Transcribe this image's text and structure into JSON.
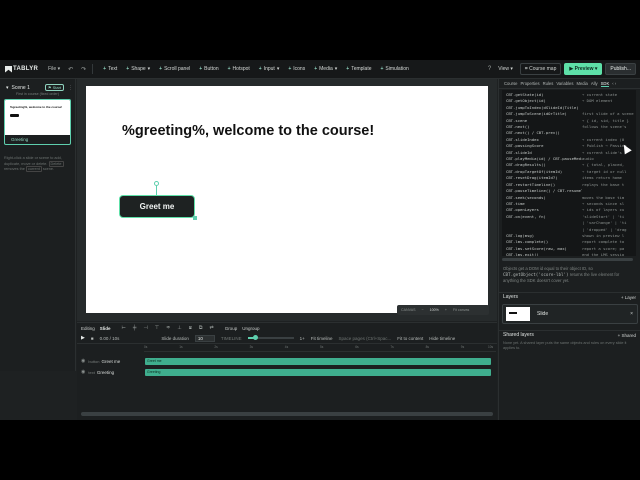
{
  "app": {
    "name": "TABLYR",
    "menu_file": "File"
  },
  "toolbar": {
    "insert": [
      {
        "label": "Text",
        "name": "text"
      },
      {
        "label": "Shape",
        "name": "shape",
        "caret": true
      },
      {
        "label": "Scroll panel",
        "name": "scroll-panel"
      },
      {
        "label": "Button",
        "name": "button"
      },
      {
        "label": "Hotspot",
        "name": "hotspot"
      },
      {
        "label": "Input",
        "name": "input",
        "caret": true
      },
      {
        "label": "Icons",
        "name": "icons"
      },
      {
        "label": "Media",
        "name": "media",
        "caret": true
      },
      {
        "label": "Template",
        "name": "template"
      },
      {
        "label": "Simulation",
        "name": "simulation"
      }
    ],
    "help": "?",
    "view": "View",
    "course_map": "Course map",
    "preview": "Preview",
    "publish": "Publish..."
  },
  "scenes": {
    "scene_title": "Scene 1",
    "start_badge": "Start",
    "scene_subtitle": "First in course (fixed order)",
    "thumb_title": "%greeting%, welcome to the course!",
    "slide_label": "Greeting",
    "help_text_1": "Right-click a slide or scene to add,",
    "help_text_2": "duplicate, move or delete.",
    "help_key": "Delete",
    "help_text_3": "removes",
    "help_text_4": "the ",
    "help_key2": "current",
    "help_text_5": " scene."
  },
  "canvas": {
    "title": "%greeting%, welcome to the course!",
    "button_label": "Greet me",
    "zoom_label": "CANVAS",
    "zoom_value": "100%",
    "fit_label": "Fit canvas"
  },
  "timeline": {
    "editing_label": "Editing",
    "editing_target": "Slide",
    "group": "Group",
    "ungroup": "Ungroup",
    "time": "0.00 / 10s",
    "duration_label": "Slide duration",
    "duration_value": "10",
    "timeline_label": "TIMELINE",
    "zoom_fraction": 0.15,
    "plus": "1+",
    "fit_timeline": "Fit timeline",
    "space_hint": "Space pages (Ctrl+Spac...",
    "fit_content": "Fit to content",
    "hide_timeline": "Hide timeline",
    "ticks": [
      "0s",
      "1s",
      "2s",
      "3s",
      "4s",
      "5s",
      "6s",
      "7s",
      "8s",
      "9s",
      "10s"
    ],
    "rows": [
      {
        "type": "button",
        "name": "Greet me",
        "bar": "Greet me"
      },
      {
        "type": "text",
        "name": "Greeting",
        "bar": "Greeting"
      }
    ]
  },
  "right_panel": {
    "tabs": [
      "Course",
      "Properties",
      "Rules",
      "Variables",
      "Media",
      "Ally",
      "SDK"
    ],
    "active_tab": "SDK",
    "code": [
      [
        "CBT.getState(id)",
        "→ current state"
      ],
      [
        "CBT.getObject(id)",
        "→ DOM element"
      ],
      [
        "CBT.jumpToIndex(dSlideId)Title)",
        ""
      ],
      [
        "CBT.jumpToScene(idOrTitle)",
        "first slide of a scene"
      ],
      [
        "CBT.scene",
        "→ { id, sid, title }"
      ],
      [
        "CBT.next()",
        "follows the scene's"
      ],
      [
        "CBT.next() / CBT.prev()",
        ""
      ],
      [
        "CBT.slideIndex",
        "→ current index (0"
      ],
      [
        "CBT.passingScore",
        "→ Publish → Passing"
      ],
      [
        "CBT.slideId",
        "→ current slide's"
      ],
      [
        "CBT.playMedia(id) / CBT.pauseMedia(id)",
        "audio"
      ],
      [
        "CBT.dragResults()",
        "→ { total, placed,"
      ],
      [
        "CBT.dropTargetOf(itemId)",
        "→ target id or null"
      ],
      [
        "CBT.resetDrag(itemId?)",
        "items return home"
      ],
      [
        "CBT.restartTimeline()",
        "replays the base t"
      ],
      [
        "CBT.pauseTimeline() / CBT.resumeTimeline()",
        ""
      ],
      [
        "CBT.seek(seconds)",
        "moves the base tim"
      ],
      [
        "CBT.time",
        "→ seconds since sl"
      ],
      [
        "CBT.openLayers",
        "→ ids of layers cu"
      ],
      [
        "CBT.on(event, fn)",
        "'slideStart' | 'ti"
      ],
      [
        "",
        "| 'varChange' | 'ti"
      ],
      [
        "",
        "| 'dropped' | 'drag"
      ],
      [
        "CBT.log(msg)",
        "shown in preview l"
      ],
      [
        "CBT.lms.complete()",
        "report complete to"
      ],
      [
        "CBT.lms.setScore(raw, max)",
        "report a score; pa"
      ],
      [
        "CBT.lms.exit()",
        "end the LMS sessio"
      ],
      [
        "CBT.lms.connected",
        "→ true when runnin"
      ],
      [
        "CBT.lms.format",
        "→ 'web' | 'scorm12'"
      ]
    ],
    "note_1": "Objects get a DOM id equal to their object ID, so",
    "note_code": "CBT.getObject('score-lbl')",
    "note_2": "returns the live",
    "note_3": "element for anything the SDK doesn't cover yet.",
    "layers_title": "Layers",
    "layers_add": "+ Layer",
    "layer_name": "Slide",
    "shared_title": "Shared layers",
    "shared_add": "+ Shared",
    "shared_text": "None yet. A shared layer puts the same objects and rules on every slide it applies to."
  },
  "colors": {
    "accent": "#5ecfae",
    "preview": "#5ee0a8",
    "bar": "#3fae8e"
  }
}
